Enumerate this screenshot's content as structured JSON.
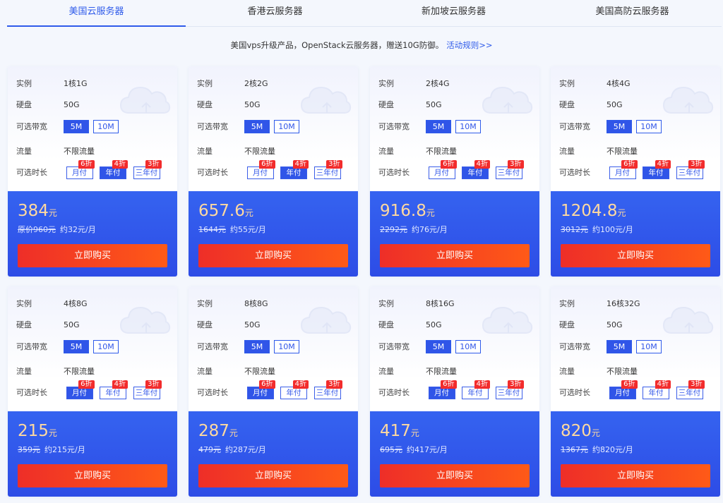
{
  "tabs": [
    "美国云服务器",
    "香港云服务器",
    "新加坡云服务器",
    "美国高防云服务器"
  ],
  "notice": {
    "text": "美国vps升级产品，OpenStack云服务器，赠送10G防御。",
    "link": "活动规则>>"
  },
  "labels": {
    "instance": "实例",
    "disk": "硬盘",
    "bandwidth": "可选带宽",
    "traffic": "流量",
    "term": "可选时长"
  },
  "bandwidth_options": [
    "5M",
    "10M"
  ],
  "term_options": [
    "月付",
    "年付",
    "三年付"
  ],
  "discounts": [
    "6折",
    "4折",
    "3折"
  ],
  "buy_label": "立即购买",
  "price_unit": "元",
  "cards": [
    {
      "instance": "1核1G",
      "disk": "50G",
      "traffic": "不限流量",
      "price": "384",
      "orig": "原价960元",
      "monthly": "约32元/月",
      "term": 1
    },
    {
      "instance": "2核2G",
      "disk": "50G",
      "traffic": "不限流量",
      "price": "657.6",
      "orig": "1644元",
      "monthly": "约55元/月",
      "term": 1
    },
    {
      "instance": "2核4G",
      "disk": "50G",
      "traffic": "不限流量",
      "price": "916.8",
      "orig": "2292元",
      "monthly": "约76元/月",
      "term": 1
    },
    {
      "instance": "4核4G",
      "disk": "50G",
      "traffic": "不限流量",
      "price": "1204.8",
      "orig": "3012元",
      "monthly": "约100元/月",
      "term": 1
    },
    {
      "instance": "4核8G",
      "disk": "50G",
      "traffic": "不限流量",
      "price": "215",
      "orig": "359元",
      "monthly": "约215元/月",
      "term": 0
    },
    {
      "instance": "8核8G",
      "disk": "50G",
      "traffic": "不限流量",
      "price": "287",
      "orig": "479元",
      "monthly": "约287元/月",
      "term": 0
    },
    {
      "instance": "8核16G",
      "disk": "50G",
      "traffic": "不限流量",
      "price": "417",
      "orig": "695元",
      "monthly": "约417元/月",
      "term": 0
    },
    {
      "instance": "16核32G",
      "disk": "50G",
      "traffic": "不限流量",
      "price": "820",
      "orig": "1367元",
      "monthly": "约820元/月",
      "term": 0
    }
  ],
  "colors": {
    "accent": "#2f5bea",
    "buy_start": "#ee2e28",
    "buy_end": "#ff5a17",
    "price": "#ffd9a0",
    "discount_badge": "#f22c2c"
  }
}
